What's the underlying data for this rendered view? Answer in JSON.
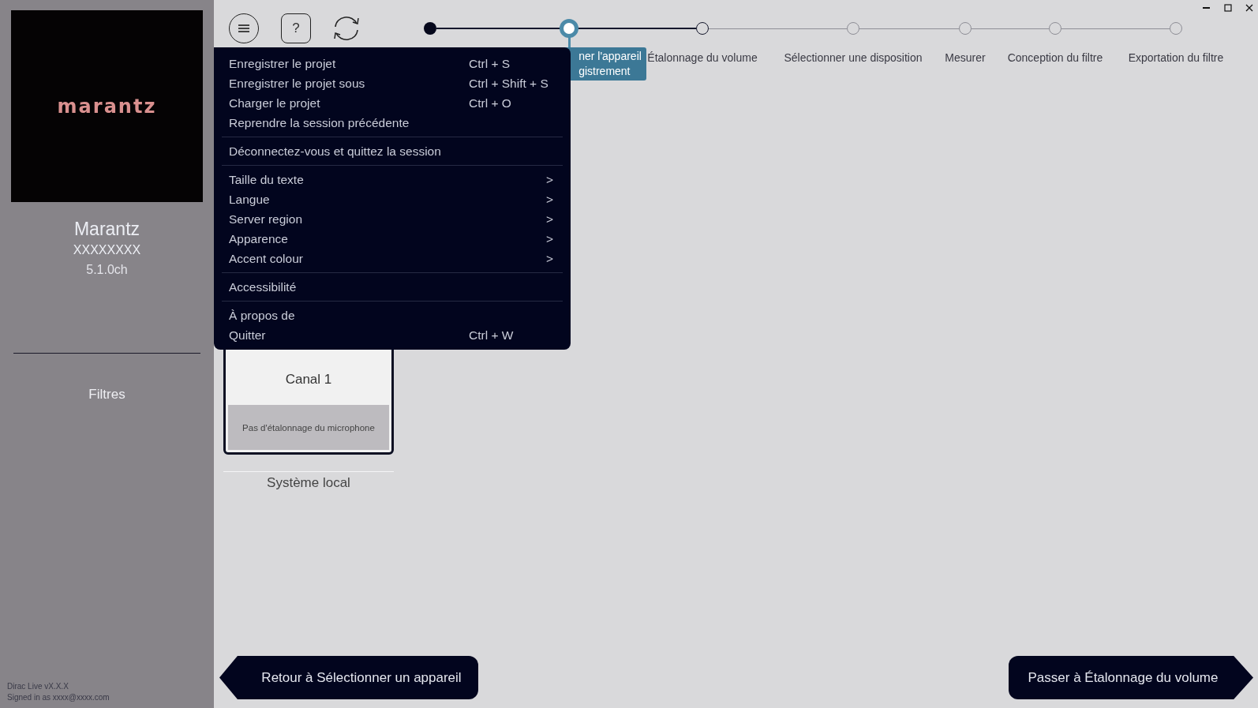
{
  "sidebar": {
    "logo_text": "marantz",
    "device_name": "Marantz",
    "model": "XXXXXXXX",
    "channels": "5.1.0ch",
    "nav_item": "Filtres",
    "footer": [
      "Dirac Live vX.X.X",
      "Signed in as xxxx@xxxx.com"
    ]
  },
  "toolbar": {
    "help_label": "?"
  },
  "steps": [
    {
      "kind": "done"
    },
    {
      "kind": "current",
      "label": "ner l'appareil\ngistrement"
    },
    {
      "kind": "next",
      "label": "Étalonnage du volume"
    },
    {
      "kind": "todo",
      "label": "Sélectionner une disposition"
    },
    {
      "kind": "todo",
      "label": "Mesurer"
    },
    {
      "kind": "todo",
      "label": "Conception du filtre"
    },
    {
      "kind": "todo",
      "label": "Exportation du filtre"
    }
  ],
  "menu": {
    "sections": [
      [
        {
          "label": "Enregistrer le projet",
          "shortcut": "Ctrl + S"
        },
        {
          "label": "Enregistrer le projet sous",
          "shortcut": "Ctrl + Shift + S"
        },
        {
          "label": "Charger le projet",
          "shortcut": "Ctrl + O"
        },
        {
          "label": "Reprendre la session précédente"
        }
      ],
      [
        {
          "label": "Déconnectez-vous et quittez la session"
        }
      ],
      [
        {
          "label": "Taille du texte",
          "arrow": ">"
        },
        {
          "label": "Langue",
          "arrow": ">"
        },
        {
          "label": "Server region",
          "arrow": ">"
        },
        {
          "label": "Apparence",
          "arrow": ">"
        },
        {
          "label": "Accent colour",
          "arrow": ">"
        }
      ],
      [
        {
          "label": "Accessibilité"
        }
      ],
      [
        {
          "label": "À propos de"
        },
        {
          "label": "Quitter",
          "shortcut": "Ctrl + W"
        }
      ]
    ]
  },
  "device_card": {
    "channel": "Canal 1",
    "calibration": "Pas d'étalonnage du microphone",
    "group": "Système local"
  },
  "buttons": {
    "back": "Retour à Sélectionner un appareil",
    "next": "Passer à Étalonnage du volume"
  }
}
